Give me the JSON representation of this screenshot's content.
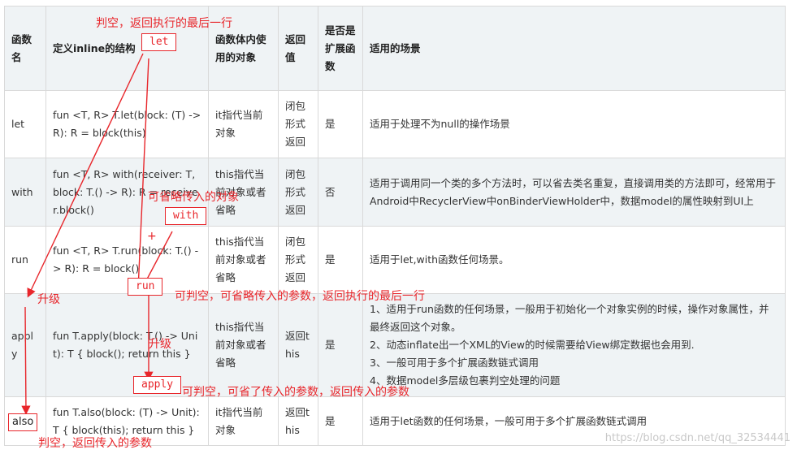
{
  "table": {
    "headers": [
      "函数名",
      "定义inline的结构",
      "函数体内使用的对象",
      "返回值",
      "是否是扩展函数",
      "适用的场景"
    ],
    "rows": [
      {
        "name": "let",
        "structure": "fun <T, R> T.let(block: (T) -> R): R = block(this)",
        "object": "it指代当前对象",
        "ret": "闭包形式返回",
        "ext": "是",
        "scene": [
          "适用于处理不为null的操作场景"
        ]
      },
      {
        "name": "with",
        "structure": "fun <T, R> with(receiver: T, block: T.() -> R): R = receiver.block()",
        "object": "this指代当前对象或者省略",
        "ret": "闭包形式返回",
        "ext": "否",
        "scene": [
          "适用于调用同一个类的多个方法时，可以省去类名重复，直接调用类的方法即可，经常用于Android中RecyclerView中onBinderViewHolder中，数据model的属性映射到UI上"
        ]
      },
      {
        "name": "run",
        "structure": "fun <T, R> T.run(block: T.() -> R): R = block()",
        "object": "this指代当前对象或者省略",
        "ret": "闭包形式返回",
        "ext": "是",
        "scene": [
          "适用于let,with函数任何场景。"
        ]
      },
      {
        "name": "apply",
        "structure": "fun T.apply(block: T.() -> Unit): T { block(); return this }",
        "object": "this指代当前对象或者省略",
        "ret": "返回this",
        "ext": "是",
        "scene": [
          "1、适用于run函数的任何场景，一般用于初始化一个对象实例的时候，操作对象属性，并最终返回这个对象。",
          "2、动态inflate出一个XML的View的时候需要给View绑定数据也会用到.",
          "3、一般可用于多个扩展函数链式调用",
          "4、数据model多层级包裹判空处理的问题"
        ]
      },
      {
        "name": "also",
        "structure": "fun T.also(block: (T) -> Unit): T { block(this); return this }",
        "object": "it指代当前对象",
        "ret": "返回this",
        "ext": "是",
        "scene": [
          "适用于let函数的任何场景，一般可用于多个扩展函数链式调用"
        ]
      }
    ]
  },
  "annotations": {
    "let_note": "判空，返回执行的最后一行",
    "let_box": "let",
    "with_note": "可省略传入的对象",
    "with_box": "with",
    "plus": "+",
    "run_box": "run",
    "run_note": "可判空，可省略传入的参数，返回执行的最后一行",
    "upgrade_1": "升级",
    "upgrade_2": "升级",
    "apply_box": "apply",
    "apply_note": "可判空，可省了传入的参数，返回传入的参数",
    "also_box": "also",
    "also_note": "判空，返回传入的参数",
    "annotation_color": "#e8262b"
  },
  "watermark": "https://blog.csdn.net/qq_32534441"
}
